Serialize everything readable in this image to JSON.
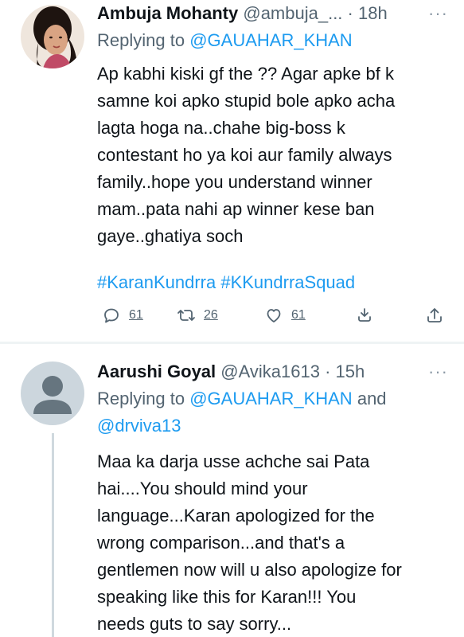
{
  "tweets": [
    {
      "author_name": "Ambuja Mohanty",
      "handle": "@ambuja_...",
      "separator": "·",
      "time": "18h",
      "more": "···",
      "reply_prefix": "Replying to",
      "reply_mentions": [
        "@GAUAHAR_KHAN"
      ],
      "text": "Ap kabhi kiski gf the ?? Agar apke bf k\nsamne koi apko stupid bole apko acha\nlagta hoga na..chahe big-boss k\ncontestant ho ya koi aur family always\nfamily..hope you understand winner\nmam..pata nahi ap winner kese ban\ngaye..ghatiya soch",
      "hashtags": [
        "#KaranKundrra",
        "#KKundrraSquad"
      ],
      "actions": {
        "reply_count": "61",
        "retweet_count": "26",
        "like_count": "61",
        "icons": [
          "reply-icon",
          "retweet-icon",
          "like-icon",
          "bookmark-icon",
          "share-icon"
        ]
      }
    },
    {
      "author_name": "Aarushi Goyal",
      "handle": "@Avika1613",
      "separator": "·",
      "time": "15h",
      "more": "···",
      "reply_prefix": "Replying to",
      "reply_mentions": [
        "@GAUAHAR_KHAN",
        "@drviva13"
      ],
      "reply_joiner": "and",
      "text": "Maa ka darja usse achche sai Pata\nhai....You should mind your\nlanguage...Karan apologized for the\nwrong comparison...and that's a\ngentlemen now will u also apologize for\nspeaking like this for Karan!!! You\nneeds guts to say sorry..."
    }
  ],
  "colors": {
    "accent": "#1d9bf0",
    "secondary_text": "#536471",
    "primary_text": "#0f1419",
    "divider": "#eff3f4",
    "thread_line": "#cfd9de",
    "default_avatar_bg": "#ccd6dd",
    "default_avatar_fg": "#66757f"
  }
}
